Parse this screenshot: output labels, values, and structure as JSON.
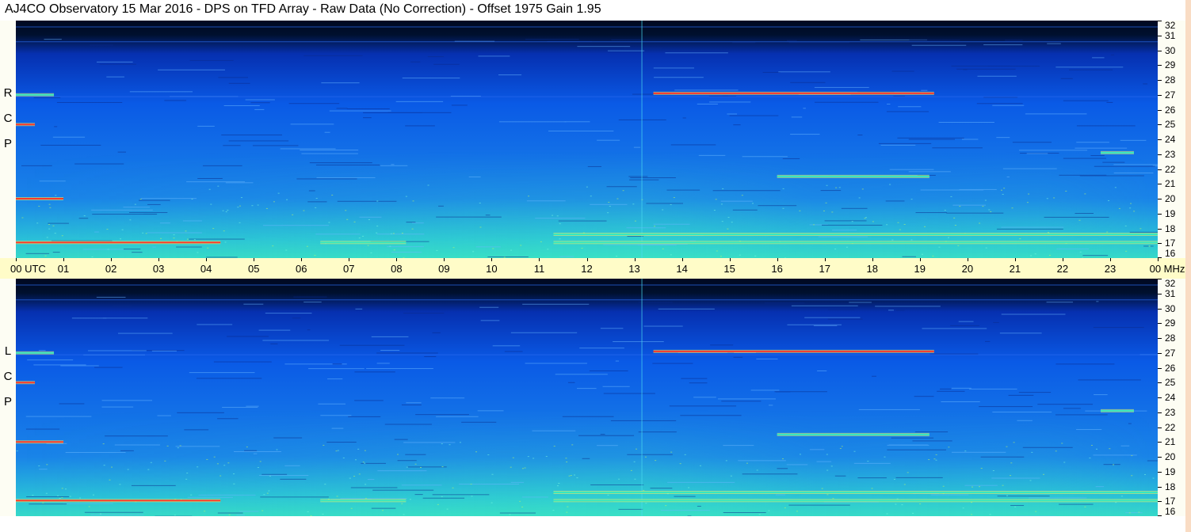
{
  "title": "AJ4CO Observatory  15 Mar 2016  -  DPS on TFD Array  -  Raw Data (No Correction)  -  Offset 1975  Gain 1.95",
  "panel_labels": [
    "R C P",
    "L C P"
  ],
  "time_axis": {
    "labels": [
      "00 UTC",
      "01",
      "02",
      "03",
      "04",
      "05",
      "06",
      "07",
      "08",
      "09",
      "10",
      "11",
      "12",
      "13",
      "14",
      "15",
      "16",
      "17",
      "18",
      "19",
      "20",
      "21",
      "22",
      "23",
      "00 MHz"
    ]
  },
  "chart_data": {
    "type": "heatmap",
    "title": "AJ4CO Observatory  15 Mar 2016  -  DPS on TFD Array  -  Raw Data (No Correction)  -  Offset 1975  Gain 1.95",
    "xlabel": "UTC",
    "ylabel": "MHz",
    "xlim": [
      0,
      24
    ],
    "ylim": [
      16,
      32
    ],
    "x_ticks": [
      "00",
      "01",
      "02",
      "03",
      "04",
      "05",
      "06",
      "07",
      "08",
      "09",
      "10",
      "11",
      "12",
      "13",
      "14",
      "15",
      "16",
      "17",
      "18",
      "19",
      "20",
      "21",
      "22",
      "23",
      "00"
    ],
    "y_ticks": [
      16,
      17,
      18,
      19,
      20,
      21,
      22,
      23,
      24,
      25,
      26,
      27,
      28,
      29,
      30,
      31,
      32
    ],
    "colors": {
      "low": "#000822",
      "mid": "#0a5ae6",
      "high": "#36e8c0",
      "peak": "#ff3a2a",
      "band": "#f2f060"
    },
    "series": [
      {
        "name": "R C P",
        "features": [
          {
            "type": "band",
            "start_utc": 0.0,
            "end_utc": 4.3,
            "freq_mhz": 17.05,
            "level": "peak"
          },
          {
            "type": "band",
            "start_utc": 6.4,
            "end_utc": 8.2,
            "freq_mhz": 17.05,
            "level": "high"
          },
          {
            "type": "band",
            "start_utc": 11.3,
            "end_utc": 24.0,
            "freq_mhz": 17.6,
            "level": "high"
          },
          {
            "type": "band",
            "start_utc": 11.3,
            "end_utc": 24.0,
            "freq_mhz": 17.05,
            "level": "high"
          },
          {
            "type": "band",
            "start_utc": 13.4,
            "end_utc": 19.3,
            "freq_mhz": 27.1,
            "level": "peak"
          },
          {
            "type": "band",
            "start_utc": 16.0,
            "end_utc": 19.2,
            "freq_mhz": 21.5,
            "level": "high"
          },
          {
            "type": "band",
            "start_utc": 0.0,
            "end_utc": 0.8,
            "freq_mhz": 27.0,
            "level": "high"
          },
          {
            "type": "band",
            "start_utc": 0.0,
            "end_utc": 1.0,
            "freq_mhz": 20.0,
            "level": "peak"
          },
          {
            "type": "band",
            "start_utc": 0.0,
            "end_utc": 0.4,
            "freq_mhz": 25.0,
            "level": "peak"
          },
          {
            "type": "band",
            "start_utc": 22.8,
            "end_utc": 23.5,
            "freq_mhz": 23.1,
            "level": "high"
          }
        ]
      },
      {
        "name": "L C P",
        "features": [
          {
            "type": "band",
            "start_utc": 0.0,
            "end_utc": 4.3,
            "freq_mhz": 17.05,
            "level": "peak"
          },
          {
            "type": "band",
            "start_utc": 6.4,
            "end_utc": 8.2,
            "freq_mhz": 17.05,
            "level": "high"
          },
          {
            "type": "band",
            "start_utc": 11.3,
            "end_utc": 24.0,
            "freq_mhz": 17.6,
            "level": "high"
          },
          {
            "type": "band",
            "start_utc": 11.3,
            "end_utc": 24.0,
            "freq_mhz": 17.05,
            "level": "high"
          },
          {
            "type": "band",
            "start_utc": 13.4,
            "end_utc": 19.3,
            "freq_mhz": 27.1,
            "level": "peak"
          },
          {
            "type": "band",
            "start_utc": 16.0,
            "end_utc": 19.2,
            "freq_mhz": 21.5,
            "level": "high"
          },
          {
            "type": "band",
            "start_utc": 0.0,
            "end_utc": 0.8,
            "freq_mhz": 27.0,
            "level": "high"
          },
          {
            "type": "band",
            "start_utc": 0.0,
            "end_utc": 1.0,
            "freq_mhz": 21.0,
            "level": "peak"
          },
          {
            "type": "band",
            "start_utc": 0.0,
            "end_utc": 0.4,
            "freq_mhz": 25.0,
            "level": "peak"
          },
          {
            "type": "band",
            "start_utc": 22.8,
            "end_utc": 23.5,
            "freq_mhz": 23.1,
            "level": "high"
          }
        ]
      }
    ]
  }
}
